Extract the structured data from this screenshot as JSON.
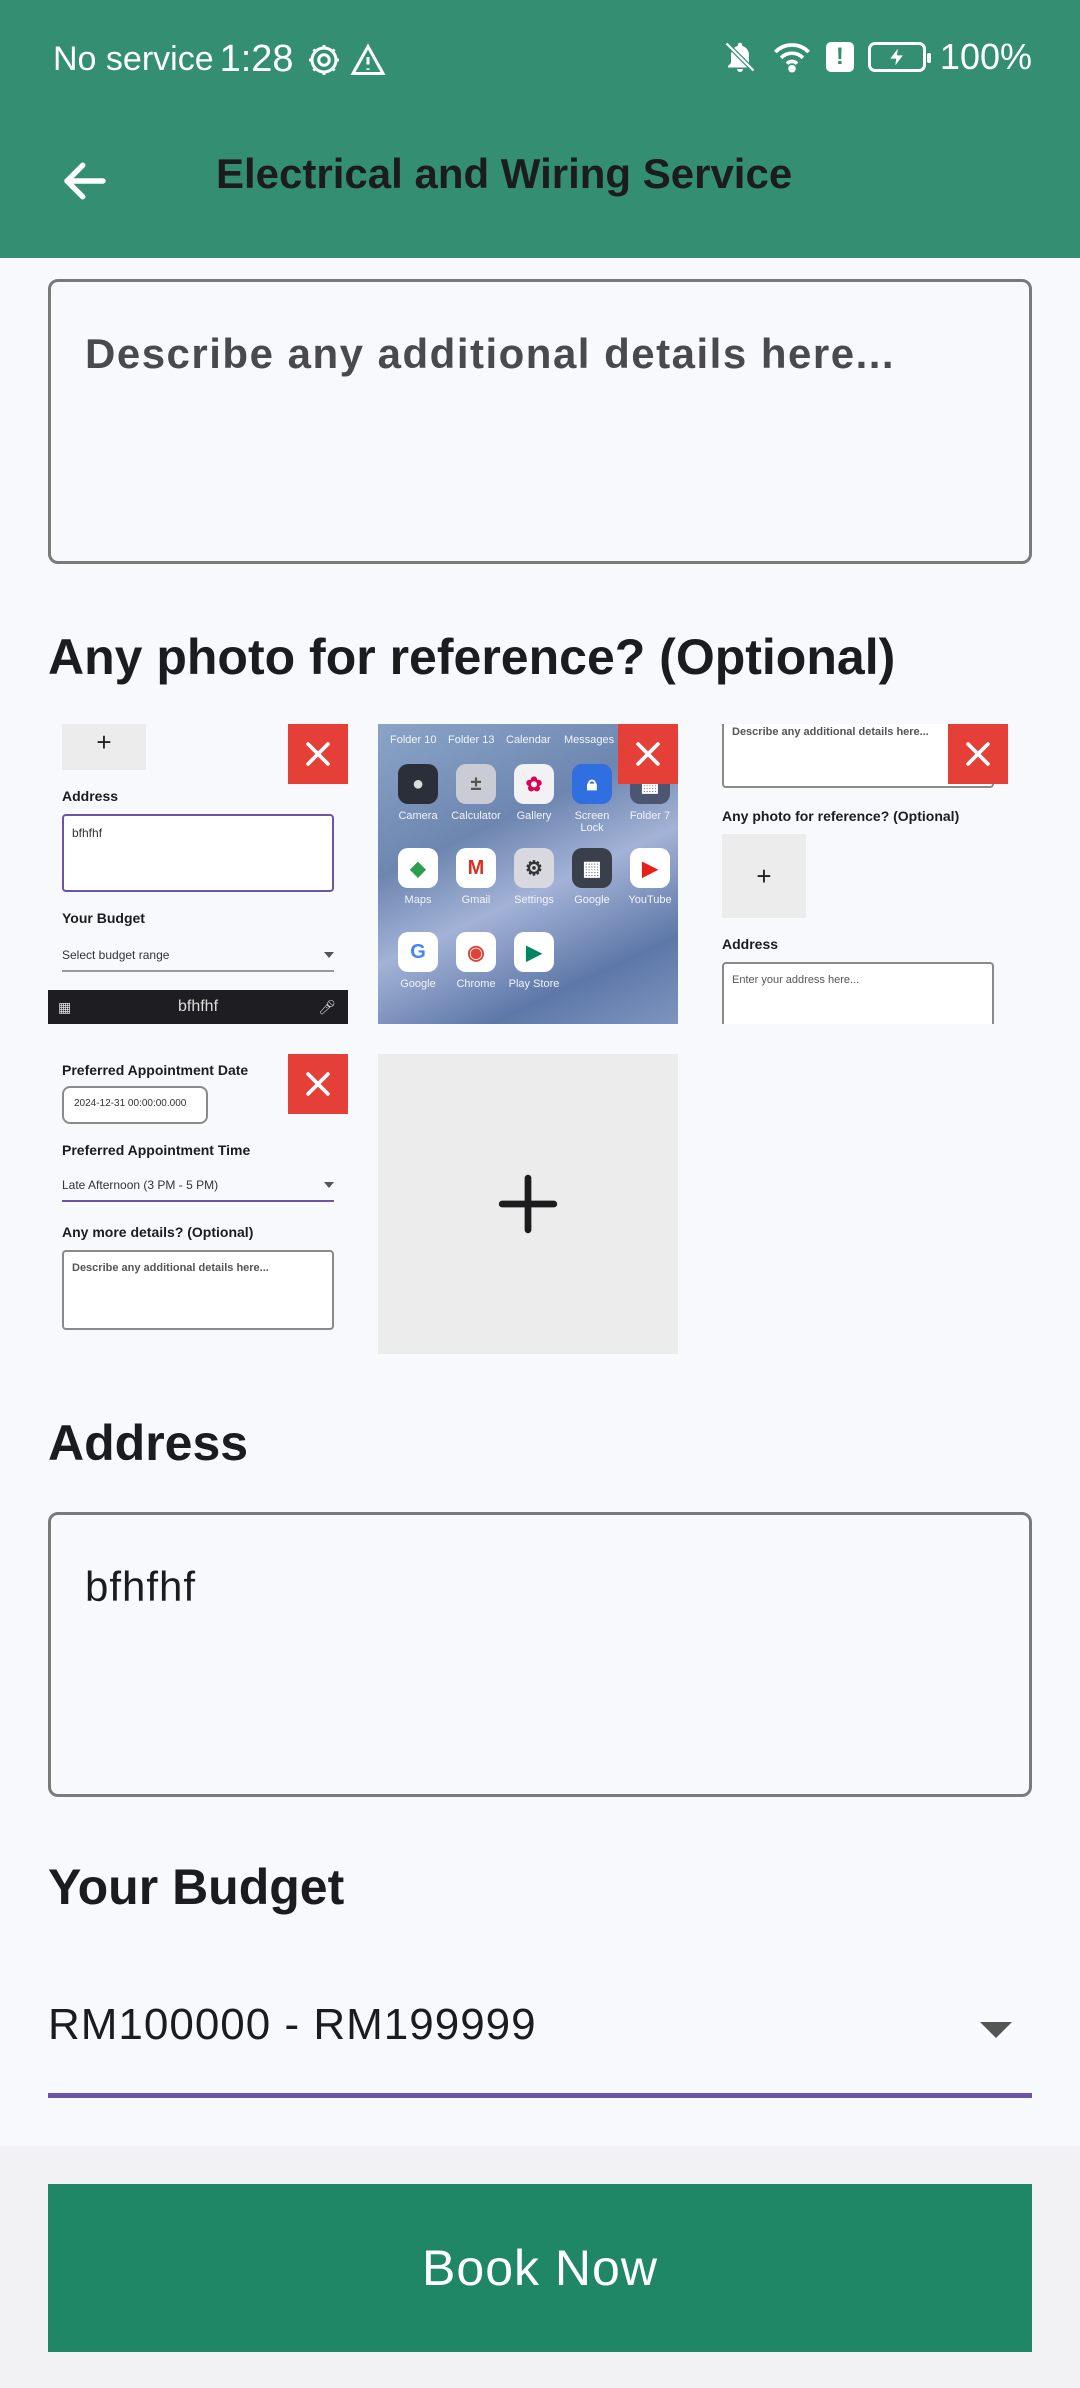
{
  "status_bar": {
    "carrier": "No service",
    "time": "1:28",
    "battery": "100%"
  },
  "app_bar": {
    "title": "Electrical and Wiring Service"
  },
  "details": {
    "placeholder": "Describe any additional details here..."
  },
  "photos": {
    "heading": "Any photo for reference? (Optional)",
    "thumb1": {
      "plus": "+",
      "address_label": "Address",
      "address_value": "bfhfhf",
      "budget_label": "Your Budget",
      "budget_placeholder": "Select budget range",
      "keyboard_text": "bfhfhf"
    },
    "thumb2": {
      "folders": [
        "Folder 10",
        "Folder 13",
        "Calendar",
        "Messages"
      ],
      "apps_row1": [
        "Camera",
        "Calculator",
        "Gallery",
        "Screen Lock",
        "Folder 7"
      ],
      "apps_row2": [
        "Maps",
        "Gmail",
        "Settings",
        "Google",
        "YouTube"
      ],
      "apps_row3": [
        "Google",
        "Chrome",
        "Play Store"
      ]
    },
    "thumb3": {
      "details_placeholder": "Describe any additional details here...",
      "photo_label": "Any photo for reference? (Optional)",
      "plus": "+",
      "address_label": "Address",
      "address_placeholder": "Enter your address here..."
    },
    "thumb4": {
      "date_label": "Preferred Appointment Date",
      "date_value": "2024-12-31 00:00:00.000",
      "time_label": "Preferred Appointment Time",
      "time_value": "Late Afternoon (3 PM - 5 PM)",
      "details_label": "Any more details? (Optional)",
      "details_placeholder": "Describe any additional details here..."
    }
  },
  "address": {
    "heading": "Address",
    "value": "bfhfhf"
  },
  "budget": {
    "heading": "Your Budget",
    "value": "RM100000 - RM199999"
  },
  "actions": {
    "book_label": "Book Now"
  },
  "colors": {
    "primary": "#348f72",
    "button": "#1f8766",
    "delete": "#e44038",
    "underline": "#6c55a8"
  }
}
